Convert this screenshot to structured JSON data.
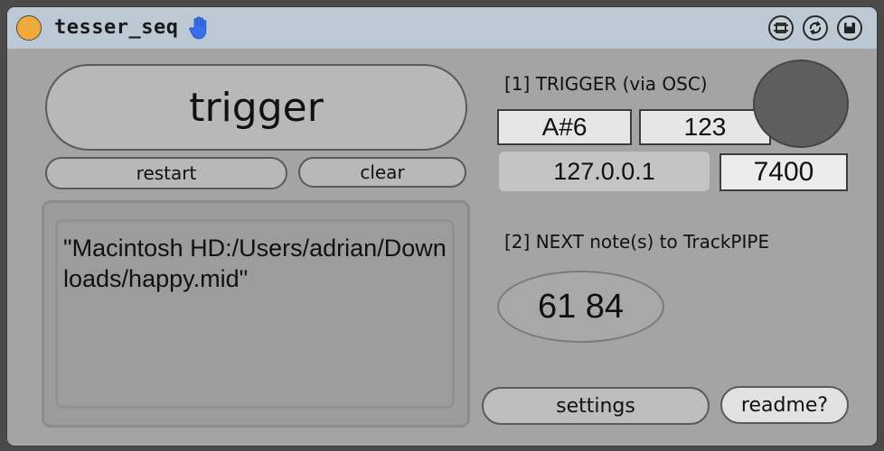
{
  "window": {
    "title": "tesser_seq"
  },
  "colors": {
    "titlebar": "#bcc9d4",
    "panel": "#a4a4a4",
    "power_on": "#f2a93b",
    "hand_icon": "#3a6ee8",
    "led": "#5e5e5e"
  },
  "icons": {
    "power": "power-toggle-icon",
    "hand": "hand-icon",
    "presentation": "presentation-icon",
    "hot_swap": "hot-swap-icon",
    "save": "save-icon"
  },
  "buttons": {
    "trigger": "trigger",
    "restart": "restart",
    "clear": "clear",
    "settings": "settings",
    "readme": "readme?"
  },
  "file": {
    "path": "\"Macintosh HD:/Users/adrian/Downloads/happy.mid\""
  },
  "osc": {
    "section_label": "[1] TRIGGER (via OSC)",
    "note": "A#6",
    "velocity": "123",
    "ip": "127.0.0.1",
    "port": "7400"
  },
  "next": {
    "section_label": "[2] NEXT note(s) to TrackPIPE",
    "notes": "61 84"
  }
}
